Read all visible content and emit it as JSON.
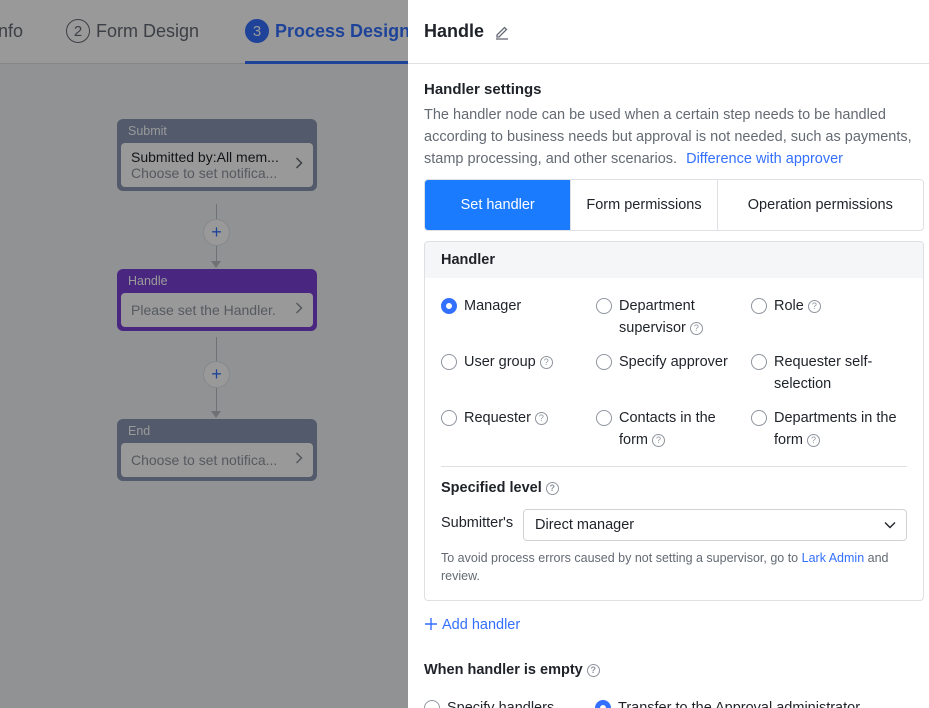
{
  "steps": [
    {
      "num": "",
      "label": "nfo"
    },
    {
      "num": "2",
      "label": "Form Design"
    },
    {
      "num": "3",
      "label": "Process Design"
    }
  ],
  "flow": {
    "submit": {
      "title": "Submit",
      "line1": "Submitted by:All mem...",
      "line2": "Choose to set notifica..."
    },
    "handle": {
      "title": "Handle",
      "line2": "Please set the Handler."
    },
    "end": {
      "title": "End",
      "line2": "Choose to set notifica..."
    },
    "add_symbol": "+"
  },
  "drawer": {
    "title": "Handle",
    "settings_title": "Handler settings",
    "description": "The handler node can be used when a certain step needs to be handled according to business needs but approval is not needed, such as payments, stamp processing, and other scenarios.",
    "difference_link": "Difference with approver",
    "tabs": [
      "Set handler",
      "Form permissions",
      "Operation permissions"
    ],
    "active_tab": "Set handler",
    "handler_panel_title": "Handler",
    "handler_options": [
      {
        "label": "Manager",
        "help": false,
        "checked": true
      },
      {
        "label": "Department supervisor",
        "help": true,
        "checked": false
      },
      {
        "label": "Role",
        "help": true,
        "checked": false
      },
      {
        "label": "User group",
        "help": true,
        "checked": false
      },
      {
        "label": "Specify approver",
        "help": false,
        "checked": false
      },
      {
        "label": "Requester self-selection",
        "help": false,
        "checked": false
      },
      {
        "label": "Requester",
        "help": true,
        "checked": false
      },
      {
        "label": "Contacts in the form",
        "help": true,
        "checked": false
      },
      {
        "label": "Departments in the form",
        "help": true,
        "checked": false
      }
    ],
    "specified_level_title": "Specified level",
    "submitter_label": "Submitter's",
    "level_value": "Direct manager",
    "note_prefix": "To avoid process errors caused by not setting a supervisor, go to",
    "note_link": "Lark Admin",
    "note_suffix": "and review.",
    "add_handler": "Add handler",
    "empty_title": "When handler is empty",
    "empty_options": [
      {
        "label": "Specify handlers",
        "checked": false
      },
      {
        "label": "Transfer to the Approval administrator",
        "checked": true
      }
    ]
  },
  "help_glyph": "?",
  "colors": {
    "accent": "#3370ff",
    "tab_active": "#1a7bff",
    "handle_node": "#7b42d8",
    "node_gray": "#8a96b5"
  }
}
